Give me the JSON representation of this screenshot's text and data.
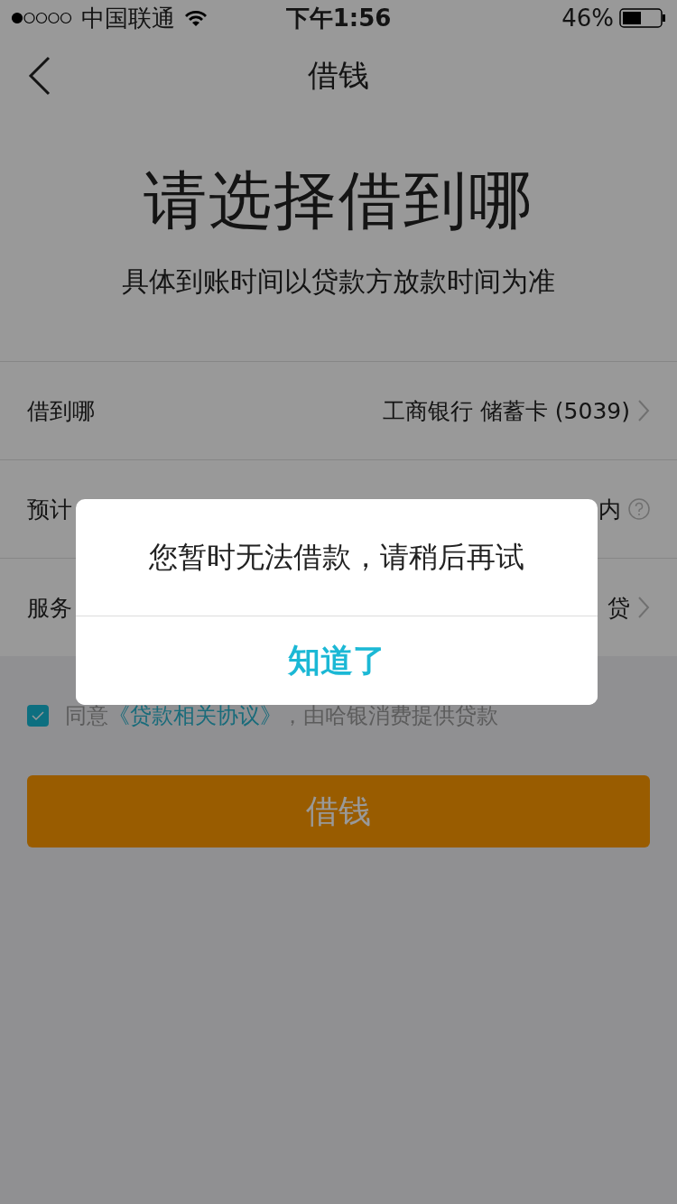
{
  "status_bar": {
    "carrier": "中国联通",
    "time": "下午1:56",
    "battery": "46%"
  },
  "nav": {
    "title": "借钱"
  },
  "heading": "请选择借到哪",
  "subheading": "具体到账时间以贷款方放款时间为准",
  "rows": [
    {
      "label": "借到哪",
      "value": "工商银行 储蓄卡 (5039)",
      "kind": "chevron"
    },
    {
      "label": "预计",
      "value": "内",
      "kind": "help"
    },
    {
      "label": "服务",
      "value": "贷",
      "kind": "chevron"
    }
  ],
  "agreement": {
    "checked": true,
    "prefix": "同意",
    "link": "《贷款相关协议》",
    "suffix": "，由哈银消费提供贷款"
  },
  "submit": "借钱",
  "dialog": {
    "message": "您暂时无法借款，请稍后再试",
    "button": "知道了"
  }
}
